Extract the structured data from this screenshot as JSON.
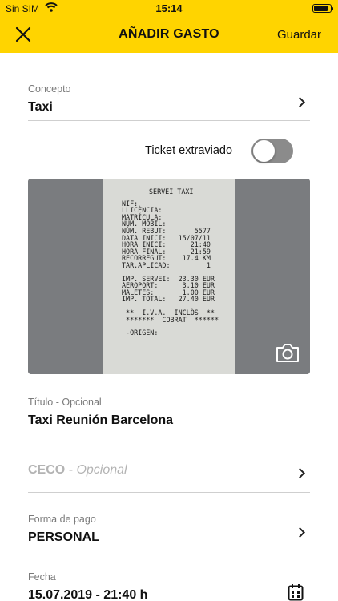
{
  "status_bar": {
    "carrier": "Sin SIM",
    "time": "15:14"
  },
  "nav": {
    "title": "AÑADIR GASTO",
    "save_label": "Guardar"
  },
  "concepto": {
    "label": "Concepto",
    "value": "Taxi"
  },
  "ticket_toggle": {
    "label": "Ticket extraviado",
    "on": false
  },
  "receipt": {
    "title": "SERVEI TAXI",
    "lines": [
      "NIF:",
      "LLICÈNCIA:",
      "MATRÍCULA:",
      "NÚM. MÒBIL:",
      "NÚM. REBUT:       5577",
      "DATA INICI:   15/07/11",
      "HORA INICI:      21:40",
      "HORA FINAL:      21:59",
      "RECORREGUT:    17.4 KM",
      "TAR.APLICAD:         1"
    ],
    "amounts": [
      "IMP. SERVEI:  23.30 EUR",
      "AEROPORT:      3.10 EUR",
      "MALETES:       1.00 EUR",
      "IMP. TOTAL:   27.40 EUR"
    ],
    "footer": [
      " **  I.V.A.  INCLÒS  **",
      " *******  COBRAT  ******",
      "",
      " -ORIGEN:"
    ]
  },
  "titulo": {
    "label": "Título - Opcional",
    "value": "Taxi Reunión Barcelona"
  },
  "ceco": {
    "label": "CECO",
    "hint": " - Opcional"
  },
  "forma_pago": {
    "label": "Forma de pago",
    "value": "PERSONAL"
  },
  "fecha": {
    "label": "Fecha",
    "value": "15.07.2019 - 21:40 h"
  },
  "colors": {
    "accent": "#FFD400",
    "toggle_off": "#8b8b8b",
    "placeholder": "#b3b3b3"
  },
  "icons": [
    "close-icon",
    "chevron-right-icon",
    "camera-icon",
    "calendar-icon",
    "wifi-icon",
    "battery-icon"
  ]
}
